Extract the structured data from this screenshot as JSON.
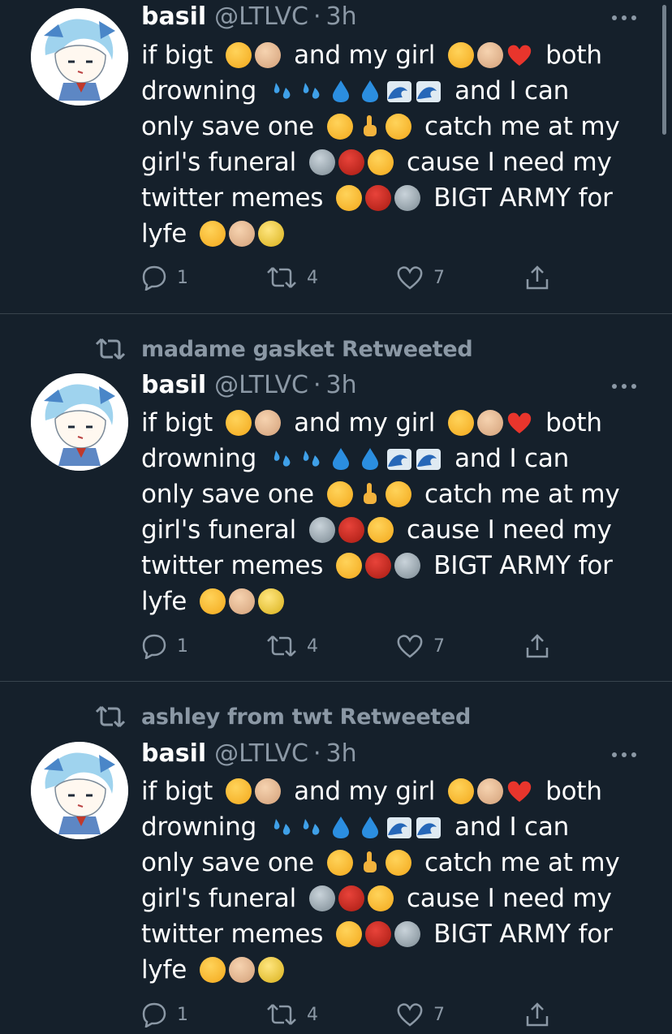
{
  "tweets": [
    {
      "retweeted_by": "",
      "name": "basil",
      "handle": "@LTLVC",
      "dot": "·",
      "time": "3h",
      "lines": [
        "if bigt",
        "and my girl",
        "both",
        "drowning",
        "and I can",
        "only save one",
        "catch me at my",
        "girl's funeral",
        "cause I need my",
        "twitter memes",
        "BIGT ARMY for",
        "lyfe"
      ],
      "replies": "1",
      "retweets": "4",
      "likes": "7"
    },
    {
      "retweeted_by": "madame gasket Retweeted",
      "name": "basil",
      "handle": "@LTLVC",
      "dot": "·",
      "time": "3h",
      "lines": [
        "if bigt",
        "and my girl",
        "both",
        "drowning",
        "and I can",
        "only save one",
        "catch me at my",
        "girl's funeral",
        "cause I need my",
        "twitter memes",
        "BIGT ARMY for",
        "lyfe"
      ],
      "replies": "1",
      "retweets": "4",
      "likes": "7"
    },
    {
      "retweeted_by": "ashley from twt Retweeted",
      "name": "basil",
      "handle": "@LTLVC",
      "dot": "·",
      "time": "3h",
      "lines": [
        "if bigt",
        "and my girl",
        "both",
        "drowning",
        "and I can",
        "only save one",
        "catch me at my",
        "girl's funeral",
        "cause I need my",
        "twitter memes",
        "BIGT ARMY for",
        "lyfe"
      ],
      "replies": "1",
      "retweets": "4",
      "likes": "7"
    }
  ],
  "colors": {
    "background": "#15202b",
    "text": "#ffffff",
    "secondary": "#8b98a5",
    "divider": "#38444d"
  },
  "icons": [
    "reply-icon",
    "retweet-icon",
    "like-icon",
    "share-icon",
    "more-icon",
    "retweeted-icon"
  ]
}
